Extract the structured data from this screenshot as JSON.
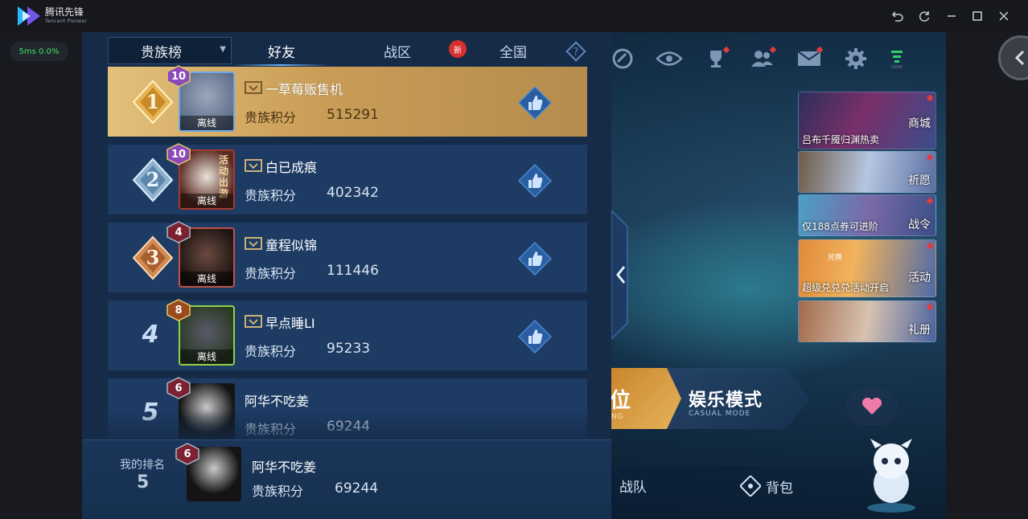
{
  "emulator": {
    "app_name": "腾讯先锋",
    "app_sub": "Tencent Pioneer",
    "perf": "5ms  0.0%",
    "controls": [
      "undo-icon",
      "refresh-icon",
      "minimize-icon",
      "maximize-icon",
      "close-icon"
    ]
  },
  "leaderboard": {
    "dropdown": "贵族榜",
    "tabs": [
      {
        "label": "好友",
        "active": true
      },
      {
        "label": "战区",
        "badge": "新"
      },
      {
        "label": "全国"
      }
    ],
    "score_label": "贵族积分",
    "offline_label": "离线",
    "rows": [
      {
        "rank": "1",
        "level": "10",
        "name": "一草莓贩售机",
        "score": "515291",
        "noble": true
      },
      {
        "rank": "2",
        "level": "10",
        "name": "白已成痕",
        "score": "402342",
        "noble": true
      },
      {
        "rank": "3",
        "level": "4",
        "name": "童程似锦",
        "score": "111446",
        "noble": true
      },
      {
        "rank": "4",
        "level": "8",
        "name": "早点睡LI",
        "score": "95233",
        "noble": true
      },
      {
        "rank": "5",
        "level": "6",
        "name": "阿华不吃姜",
        "score": "69244",
        "noble": false
      }
    ],
    "avatar_tag": "活动出游",
    "my_rank": {
      "title": "我的排名",
      "rank": "5",
      "level": "6",
      "name": "阿华不吃姜",
      "score_label": "贵族积分",
      "score": "69244"
    }
  },
  "game_ui": {
    "promos": [
      {
        "caption": "吕布千魇归渊热卖",
        "label": "商城"
      },
      {
        "caption": "",
        "label": "祈愿"
      },
      {
        "caption": "仅188点券可进阶",
        "label": "战令"
      },
      {
        "caption": "超级兑兑兑活动开启",
        "label": "活动",
        "tag": "兑换"
      },
      {
        "caption": "",
        "label": "礼册"
      }
    ],
    "mode_left": "位",
    "mode_left_sub": "NG",
    "mode_right": "娱乐模式",
    "mode_right_sub": "CASUAL MODE",
    "bottom_buttons": [
      "战队",
      "背包"
    ]
  },
  "colors": {
    "panel_bg": "#152b48",
    "row_bg": "#1d3b63",
    "gold_row": "#d8b46b",
    "accent_blue": "#67b5ff",
    "badge_red": "#d8302f"
  }
}
